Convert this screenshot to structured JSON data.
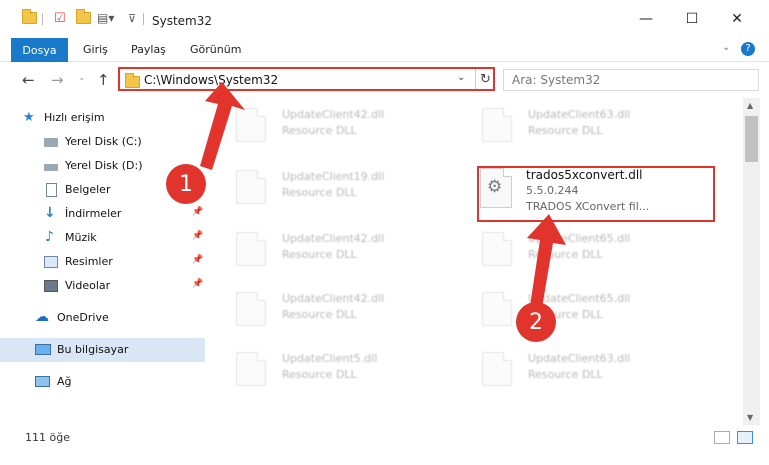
{
  "window": {
    "title": "System32",
    "controls": {
      "minimize": "—",
      "maximize": "☐",
      "close": "✕"
    }
  },
  "ribbon": {
    "tabs": [
      {
        "label": "Dosya"
      },
      {
        "label": "Giriş"
      },
      {
        "label": "Paylaş"
      },
      {
        "label": "Görünüm"
      }
    ],
    "help": "?"
  },
  "address": {
    "path": "C:\\Windows\\System32",
    "search_placeholder": "Ara: System32"
  },
  "sidebar": {
    "items": [
      {
        "label": "Hızlı erişim"
      },
      {
        "label": "Yerel Disk (C:)"
      },
      {
        "label": "Yerel Disk (D:)"
      },
      {
        "label": "Belgeler"
      },
      {
        "label": "İndirmeler"
      },
      {
        "label": "Müzik"
      },
      {
        "label": "Resimler"
      },
      {
        "label": "Videolar"
      },
      {
        "label": "OneDrive"
      },
      {
        "label": "Bu bilgisayar"
      },
      {
        "label": "Ağ"
      }
    ]
  },
  "files": [
    {
      "name": "UpdateClient42.dll",
      "type": "Resource DLL"
    },
    {
      "name": "UpdateClient63.dll",
      "type": "Resource DLL"
    },
    {
      "name": "UpdateClient19.dll",
      "type": "Resource DLL"
    },
    {
      "name": "trados5xconvert.dll",
      "version": "5.5.0.244",
      "desc": "TRADOS XConvert fil..."
    },
    {
      "name": "UpdateClient42.dll",
      "type": "Resource DLL"
    },
    {
      "name": "UpdateClient65.dll",
      "type": "Resource DLL"
    },
    {
      "name": "UpdateClient42.dll",
      "type": "Resource DLL"
    },
    {
      "name": "UpdateClient65.dll",
      "type": "Resource DLL"
    },
    {
      "name": "UpdateClient5.dll",
      "type": "Resource DLL"
    },
    {
      "name": "UpdateClient63.dll",
      "type": "Resource DLL"
    }
  ],
  "status": {
    "count": "111 öğe"
  },
  "annotations": {
    "step1": "1",
    "step2": "2",
    "color": "#e0342c"
  },
  "colors": {
    "accent": "#1979ca",
    "highlight": "#e0342c",
    "selection": "#d9e6f5"
  }
}
